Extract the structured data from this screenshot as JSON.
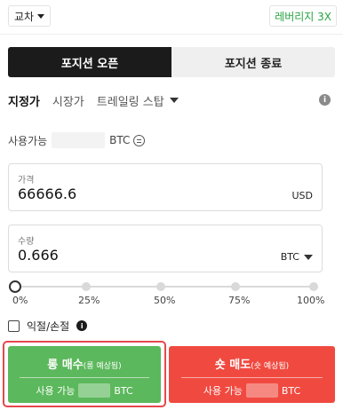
{
  "topbar": {
    "mode": "교차",
    "leverage": "레버리지 3X"
  },
  "position_tabs": {
    "open": "포지션 오픈",
    "close": "포지션 종료"
  },
  "order_types": {
    "limit": "지정가",
    "market": "시장가",
    "trailing": "트레일링 스탑"
  },
  "available": {
    "label": "사용가능",
    "unit": "BTC"
  },
  "price": {
    "label": "가격",
    "value": "66666.6",
    "unit": "USD"
  },
  "quantity": {
    "label": "수량",
    "value": "0.666",
    "unit": "BTC"
  },
  "slider": {
    "level": 0,
    "marks": [
      "0%",
      "25%",
      "50%",
      "75%",
      "100%"
    ]
  },
  "tpsl": {
    "label": "익절/손절"
  },
  "buy": {
    "title": "롱 매수",
    "note": "(롱 예상됨)",
    "avail_label": "사용 가능",
    "unit": "BTC",
    "color": "#5cb85c"
  },
  "sell": {
    "title": "숏 매도",
    "note": "(숏 예상됨)",
    "avail_label": "사용 가능",
    "unit": "BTC",
    "color": "#f04a40"
  },
  "colors": {
    "leverage": "#27a343",
    "active_tab": "#1b1b1b",
    "highlight": "#e5484d"
  },
  "icons": {
    "info": "info-icon",
    "swap": "swap-icon",
    "caret": "chevron-down-icon"
  }
}
